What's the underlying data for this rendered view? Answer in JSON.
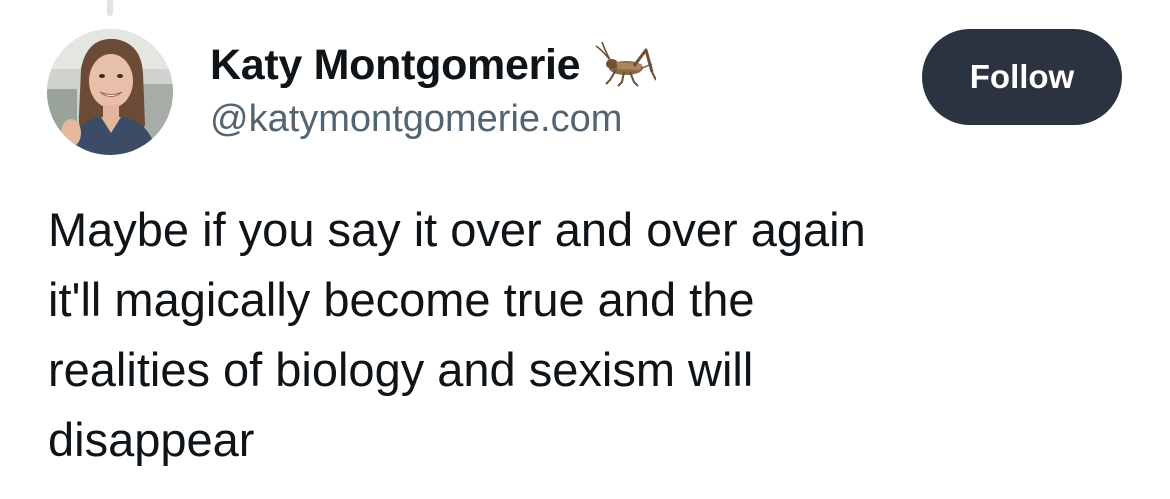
{
  "author": {
    "display_name": "Katy Montgomerie",
    "handle": "@katymontgomerie.com",
    "badge_icon": "cricket-icon"
  },
  "follow_button": {
    "label": "Follow",
    "color": "#2b3340"
  },
  "post": {
    "lines": [
      "Maybe if you say it over and over again",
      "it'll magically become true and the",
      "realities of biology and sexism will",
      "disappear"
    ]
  }
}
